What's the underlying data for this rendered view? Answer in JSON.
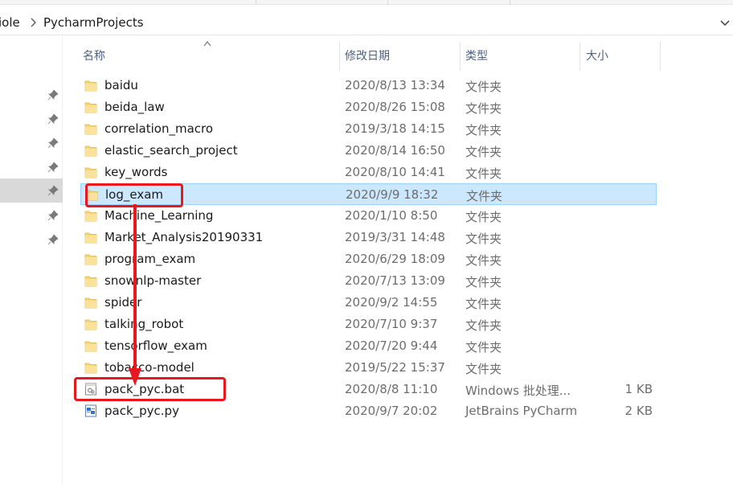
{
  "address_bar": {
    "crumb_partial": "iole",
    "crumb_current": "PycharmProjects"
  },
  "columns": {
    "name": "名称",
    "date": "修改日期",
    "type": "类型",
    "size": "大小"
  },
  "files": [
    {
      "name": "baidu",
      "date": "2020/8/13 13:34",
      "type": "文件夹",
      "size": "",
      "icon": "folder-icon"
    },
    {
      "name": "beida_law",
      "date": "2020/8/26 15:08",
      "type": "文件夹",
      "size": "",
      "icon": "folder-icon"
    },
    {
      "name": "correlation_macro",
      "date": "2019/3/18 14:15",
      "type": "文件夹",
      "size": "",
      "icon": "folder-icon"
    },
    {
      "name": "elastic_search_project",
      "date": "2020/8/14 16:50",
      "type": "文件夹",
      "size": "",
      "icon": "folder-icon"
    },
    {
      "name": "key_words",
      "date": "2020/8/10 14:41",
      "type": "文件夹",
      "size": "",
      "icon": "folder-icon"
    },
    {
      "name": "log_exam",
      "date": "2020/9/9 18:32",
      "type": "文件夹",
      "size": "",
      "icon": "folder-icon",
      "selected": true
    },
    {
      "name": "Machine_Learning",
      "date": "2020/1/10 8:50",
      "type": "文件夹",
      "size": "",
      "icon": "folder-icon"
    },
    {
      "name": "Market_Analysis20190331",
      "date": "2019/3/31 14:48",
      "type": "文件夹",
      "size": "",
      "icon": "folder-icon"
    },
    {
      "name": "program_exam",
      "date": "2020/6/29 18:09",
      "type": "文件夹",
      "size": "",
      "icon": "folder-icon"
    },
    {
      "name": "snownlp-master",
      "date": "2020/7/13 13:09",
      "type": "文件夹",
      "size": "",
      "icon": "folder-icon"
    },
    {
      "name": "spider",
      "date": "2020/9/2 14:55",
      "type": "文件夹",
      "size": "",
      "icon": "folder-icon"
    },
    {
      "name": "talking_robot",
      "date": "2020/7/10 9:37",
      "type": "文件夹",
      "size": "",
      "icon": "folder-icon"
    },
    {
      "name": "tensorflow_exam",
      "date": "2020/7/20 9:44",
      "type": "文件夹",
      "size": "",
      "icon": "folder-icon"
    },
    {
      "name": "tobacco-model",
      "date": "2019/5/22 15:37",
      "type": "文件夹",
      "size": "",
      "icon": "folder-icon"
    },
    {
      "name": "pack_pyc.bat",
      "date": "2020/8/8 11:10",
      "type": "Windows 批处理...",
      "size": "1 KB",
      "icon": "batch-file-icon"
    },
    {
      "name": "pack_pyc.py",
      "date": "2020/9/7 20:02",
      "type": "JetBrains PyCharm",
      "size": "2 KB",
      "icon": "python-file-icon"
    }
  ],
  "colors": {
    "selection_bg": "#cce8ff",
    "selection_border": "#99d1ff",
    "annotation_red": "#e8181f",
    "folder_yellow": "#f8d775"
  }
}
